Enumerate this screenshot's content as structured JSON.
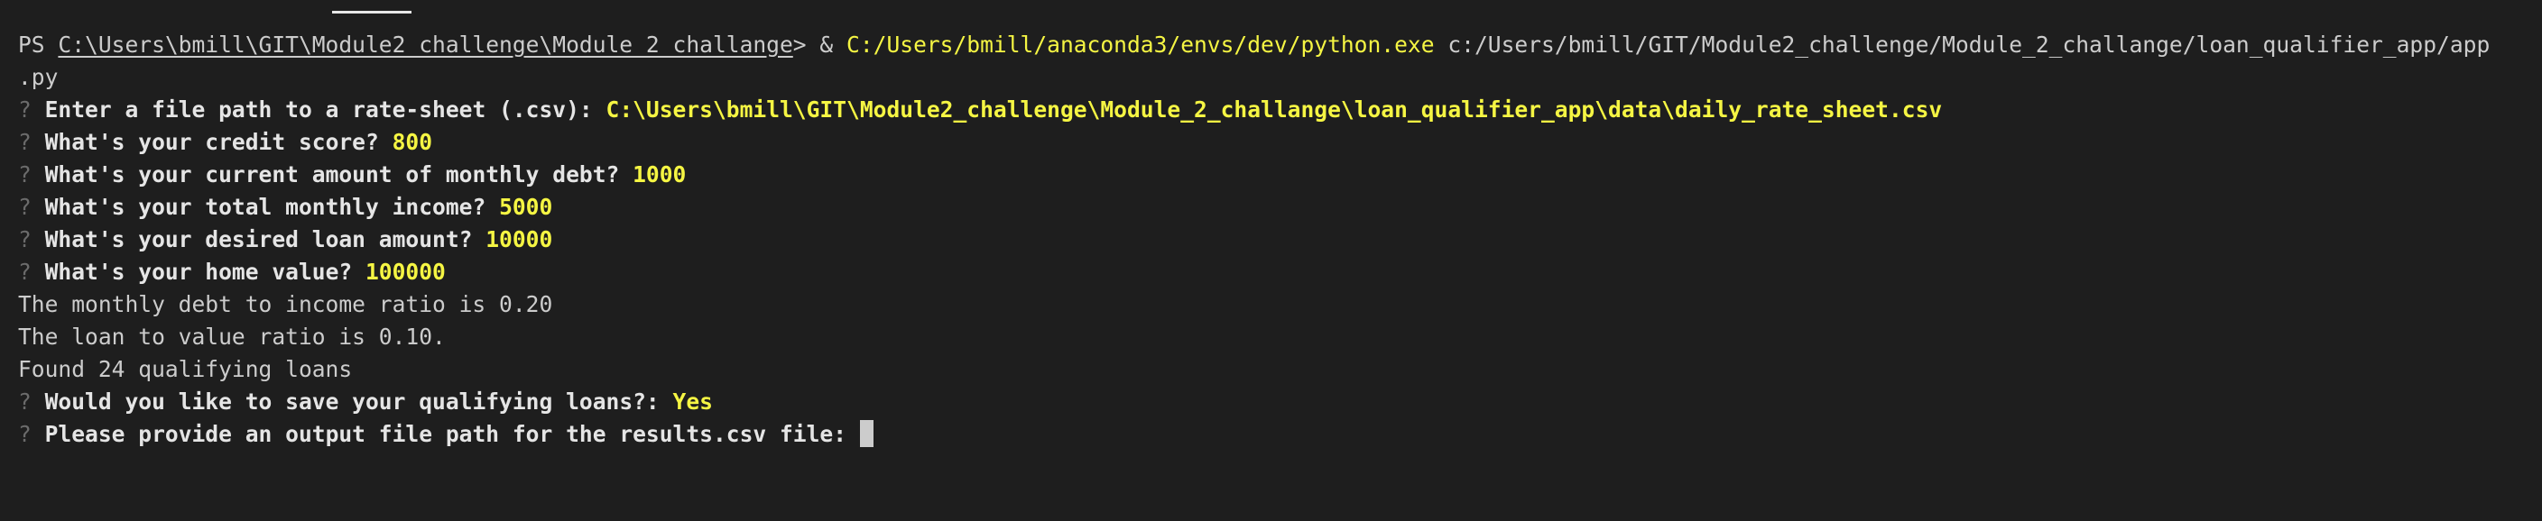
{
  "terminal": {
    "command": {
      "prompt_prefix": "PS ",
      "cwd": "C:\\Users\\bmill\\GIT\\Module2_challenge\\Module_2_challange",
      "prompt_suffix": "> & ",
      "executable": "C:/Users/bmill/anaconda3/envs/dev/python.exe",
      "script": " c:/Users/bmill/GIT/Module2_challenge/Module_2_challange/loan_qualifier_app/app",
      "script_wrap": ".py"
    },
    "prompt_mark": "?",
    "questions": [
      {
        "label": "Enter a file path to a rate-sheet (.csv): ",
        "answer": "C:\\Users\\bmill\\GIT\\Module2_challenge\\Module_2_challange\\loan_qualifier_app\\data\\daily_rate_sheet.csv"
      },
      {
        "label": "What's your credit score? ",
        "answer": "800"
      },
      {
        "label": "What's your current amount of monthly debt? ",
        "answer": "1000"
      },
      {
        "label": "What's your total monthly income? ",
        "answer": "5000"
      },
      {
        "label": "What's your desired loan amount? ",
        "answer": "10000"
      },
      {
        "label": "What's your home value? ",
        "answer": "100000"
      }
    ],
    "outputs": [
      "The monthly debt to income ratio is 0.20",
      "The loan to value ratio is 0.10.",
      "Found 24 qualifying loans"
    ],
    "save_question": {
      "label": "Would you like to save your qualifying loans?: ",
      "answer": "Yes"
    },
    "path_question": {
      "label": "Please provide an output file path for the results.csv file: "
    }
  },
  "colors": {
    "background": "#1e1e1e",
    "text": "#cccccc",
    "answer": "#f5f543"
  }
}
